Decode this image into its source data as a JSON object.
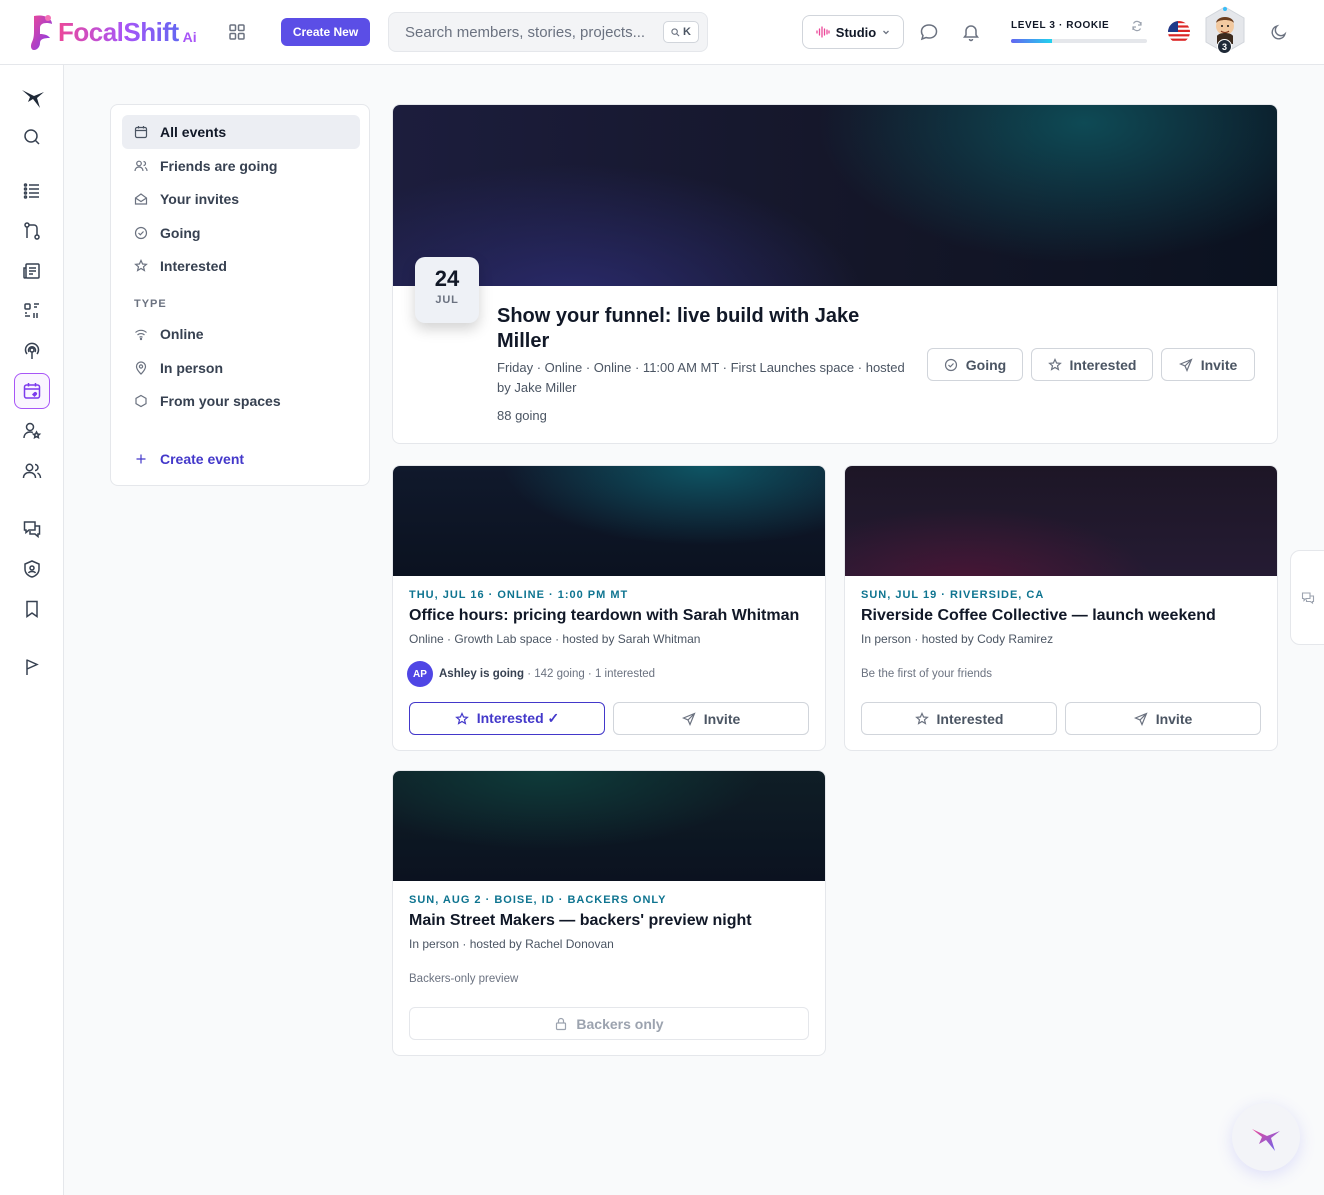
{
  "header": {
    "logo_text": "FocalShift",
    "logo_suffix": "Ai",
    "create_button": "Create New",
    "search_placeholder": "Search members, stories, projects...",
    "search_shortcut": "K",
    "studio_label": "Studio",
    "level_label": "LEVEL 3 · ROOKIE",
    "level_progress": 0.3,
    "avatar_badge": "3",
    "icons": [
      "grid-icon",
      "waveform-icon",
      "chat-icon",
      "bell-icon",
      "refresh-icon",
      "us-flag-icon",
      "moon-icon"
    ]
  },
  "rail": {
    "icons": [
      "hummingbird-logo-icon",
      "search-icon",
      "feed-list-icon",
      "git-branch-icon",
      "newspaper-icon",
      "grid-dots-icon",
      "podcast-icon",
      "calendar-icon",
      "user-star-icon",
      "users-icon",
      "messages-icon",
      "shield-icon",
      "bookmark-icon",
      "flag-icon"
    ],
    "active": "calendar-icon"
  },
  "filters": {
    "items": [
      {
        "label": "All events",
        "icon": "calendar-icon",
        "active": true
      },
      {
        "label": "Friends are going",
        "icon": "users-icon"
      },
      {
        "label": "Your invites",
        "icon": "envelope-open-icon"
      },
      {
        "label": "Going",
        "icon": "check-circle-icon"
      },
      {
        "label": "Interested",
        "icon": "star-icon"
      }
    ],
    "type_heading": "TYPE",
    "types": [
      {
        "label": "Online",
        "icon": "wifi-icon"
      },
      {
        "label": "In person",
        "icon": "map-pin-icon"
      },
      {
        "label": "From your spaces",
        "icon": "hexagon-icon"
      }
    ],
    "create_label": "Create event"
  },
  "featured": {
    "day": "24",
    "month": "JUL",
    "title": "Show your funnel: live build with Jake Miller",
    "meta": "Friday · Online · Online · 11:00 AM MT · First Launches space · hosted by Jake Miller",
    "going": "88 going",
    "buttons": {
      "going": "Going",
      "interested": "Interested",
      "invite": "Invite"
    }
  },
  "events": [
    {
      "kicker": "THU, JUL 16 · ONLINE · 1:00 PM MT",
      "title": "Office hours: pricing teardown with Sarah Whitman",
      "subtitle": "Online · Growth Lab space · hosted by Sarah Whitman",
      "avatar_initials": "AP",
      "friend": "Ashley is going",
      "social": " · 142 going · 1 interested",
      "interested": "Interested ✓",
      "invite": "Invite"
    },
    {
      "kicker": "SUN, JUL 19 · RIVERSIDE, CA",
      "title": "Riverside Coffee Collective — launch weekend",
      "subtitle": "In person · hosted by Cody Ramirez",
      "social": "Be the first of your friends",
      "interested": "Interested",
      "invite": "Invite"
    },
    {
      "kicker": "SUN, AUG 2 · BOISE, ID · BACKERS ONLY",
      "title": "Main Street Makers — backers' preview night",
      "subtitle": "In person · hosted by Rachel Donovan",
      "social": "Backers-only preview",
      "locked_label": "Backers only"
    }
  ],
  "colors": {
    "accent": "#5b4ee6",
    "kicker": "#0e7490",
    "active_outline": "#a855f7"
  }
}
